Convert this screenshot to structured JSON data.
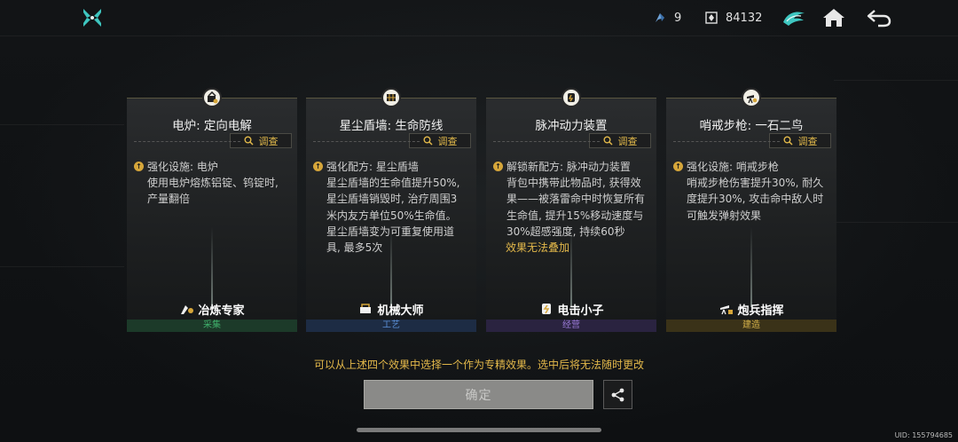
{
  "topbar": {
    "gem_count": "9",
    "coin_count": "84132",
    "icons": [
      "logo-icon",
      "gem-icon",
      "coin-icon",
      "emblem-icon",
      "home-icon",
      "back-icon"
    ]
  },
  "cards": [
    {
      "title": "电炉: 定向电解",
      "inspect_label": "调查",
      "head": "强化设施: 电炉",
      "desc": "使用电炉熔炼铝锭、钨锭时, 产量翻倍",
      "warn": "",
      "profession": "冶炼专家",
      "category": "采集",
      "category_color": "#3fae6a",
      "category_bg": "#1c3a29",
      "icon": "furnace-icon"
    },
    {
      "title": "星尘盾墙: 生命防线",
      "inspect_label": "调查",
      "head": "强化配方: 星尘盾墙",
      "desc": "星尘盾墙的生命值提升50%, 星尘盾墙销毁时, 治疗周围3米内友方单位50%生命值。星尘盾墙变为可重复使用道具, 最多5次",
      "warn": "",
      "profession": "机械大师",
      "category": "工艺",
      "category_color": "#5b8fd6",
      "category_bg": "#1d2c44",
      "icon": "shield-wall-icon"
    },
    {
      "title": "脉冲动力装置",
      "inspect_label": "调查",
      "head": "解锁新配方: 脉冲动力装置",
      "desc": "背包中携带此物品时, 获得效果——被落雷命中时恢复所有生命值, 提升15%移动速度与30%超感强度, 持续60秒",
      "warn": "效果无法叠加",
      "profession": "电击小子",
      "category": "经营",
      "category_color": "#9a7ad6",
      "category_bg": "#2a2340",
      "icon": "pulse-device-icon"
    },
    {
      "title": "哨戒步枪: 一石二鸟",
      "inspect_label": "调查",
      "head": "强化设施: 哨戒步枪",
      "desc": "哨戒步枪伤害提升30%, 耐久度提升30%, 攻击命中敌人时可触发弹射效果",
      "warn": "",
      "profession": "炮兵指挥",
      "category": "建造",
      "category_color": "#d6b24a",
      "category_bg": "#3a3218",
      "icon": "turret-icon"
    }
  ],
  "hint": "可以从上述四个效果中选择一个作为专精效果。选中后将无法随时更改",
  "confirm_label": "确定",
  "uid": "UID: 155794685"
}
